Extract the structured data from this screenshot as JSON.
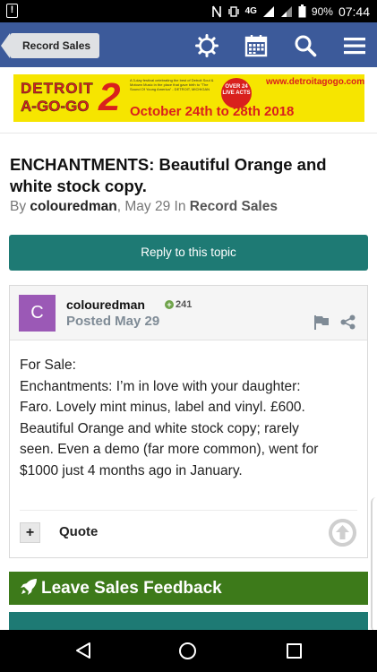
{
  "status_bar": {
    "network": "4G",
    "battery": "90%",
    "time": "07:44"
  },
  "header": {
    "back_label": "Record Sales",
    "icons": [
      "gear-icon",
      "calendar-icon",
      "search-icon",
      "menu-icon"
    ],
    "color": "#3c5a9a"
  },
  "banner": {
    "line1": "DETROIT",
    "line2": "A-GO-GO",
    "number": "2",
    "tagline": "A 3-day festival celebrating the best of Detroit Soul & Motown Music in the place that gave birth to \"The Sound Of Young America\" - DETROIT, MICHIGAN",
    "badge": "OVER 24 LIVE ACTS",
    "url": "www.detroitagogo.com",
    "dates": "October 24th to 28th 2018"
  },
  "topic": {
    "title": "ENCHANTMENTS: Beautiful Orange and white stock copy.",
    "by": "By",
    "author": "colouredman",
    "date": "May 29",
    "in": "In",
    "forum": "Record Sales"
  },
  "reply_button": "Reply to this topic",
  "post": {
    "avatar_letter": "C",
    "author": "colouredman",
    "reputation": "241",
    "posted": "Posted May 29",
    "body_lines": [
      "For Sale:",
      "Enchantments: I’m in love with your daughter:",
      "Faro. Lovely mint minus, label and vinyl. £600.",
      "Beautiful Orange and white stock copy; rarely",
      "seen. Even a demo (far more common), went for",
      "$1000 just 4 months ago in January."
    ],
    "quote_plus": "+",
    "quote_label": "Quote"
  },
  "feedback_button": "Leave Sales Feedback",
  "colors": {
    "accent_teal": "#1e7a74",
    "feedback_green": "#3d7a1a",
    "avatar_purple": "#9b59b6"
  }
}
